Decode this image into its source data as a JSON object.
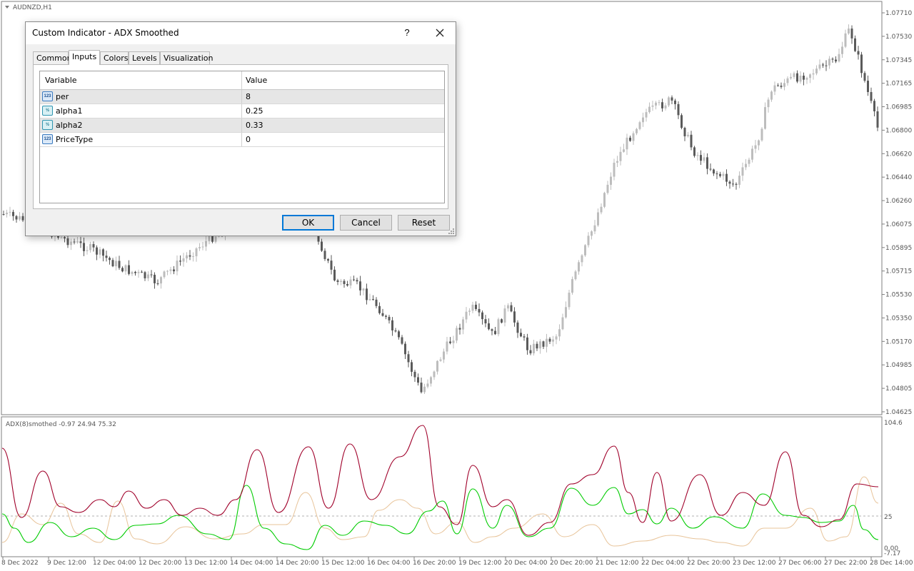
{
  "chart": {
    "symbol": "AUDNZD,H1",
    "indicator_label": "ADX(8)smothed -0.97 24.94 75.32",
    "price_labels": [
      "1.07710",
      "1.07530",
      "1.07345",
      "1.07165",
      "1.06985",
      "1.06800",
      "1.06620",
      "1.06440",
      "1.06260",
      "1.06075",
      "1.05895",
      "1.05715",
      "1.05530",
      "1.05350",
      "1.05170",
      "1.04985",
      "1.04805",
      "1.04625"
    ],
    "indicator_scale": [
      "104.6",
      "25",
      "0.00",
      "-7.17"
    ],
    "time_labels": [
      "8 Dec 2022",
      "9 Dec 12:00",
      "12 Dec 04:00",
      "12 Dec 20:00",
      "13 Dec 12:00",
      "14 Dec 04:00",
      "14 Dec 20:00",
      "15 Dec 12:00",
      "16 Dec 04:00",
      "16 Dec 20:00",
      "19 Dec 12:00",
      "20 Dec 04:00",
      "20 Dec 20:00",
      "21 Dec 12:00",
      "22 Dec 04:00",
      "22 Dec 20:00",
      "23 Dec 12:00",
      "27 Dec 06:00",
      "27 Dec 22:00",
      "28 Dec 14:00"
    ],
    "colors": {
      "bull": "#bdbdbd",
      "bear": "#5a5a5a",
      "plus_di": "#00cc00",
      "minus_di": "#a0002a",
      "adx": "#e8c49a",
      "level": "#b0b0b0"
    }
  },
  "dialog": {
    "title": "Custom Indicator - ADX Smoothed",
    "help": "?",
    "tabs": [
      "Common",
      "Inputs",
      "Colors",
      "Levels",
      "Visualization"
    ],
    "active_tab": "Inputs",
    "columns": {
      "variable": "Variable",
      "value": "Value"
    },
    "inputs": [
      {
        "icon": "123",
        "name": "per",
        "value": "8"
      },
      {
        "icon": "½",
        "name": "alpha1",
        "value": "0.25"
      },
      {
        "icon": "½",
        "name": "alpha2",
        "value": "0.33"
      },
      {
        "icon": "123",
        "name": "PriceType",
        "value": "0"
      }
    ],
    "buttons": {
      "ok": "OK",
      "cancel": "Cancel",
      "reset": "Reset"
    }
  }
}
